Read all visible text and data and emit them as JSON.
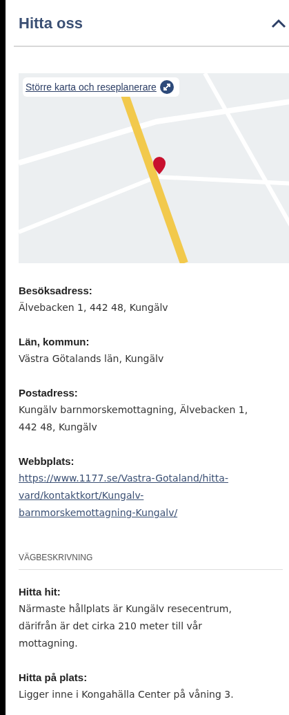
{
  "section": {
    "title": "Hitta oss",
    "expanded": true
  },
  "map": {
    "link": "Större karta och reseplanerare"
  },
  "details": [
    {
      "label": "Besöksadress:",
      "kind": "text",
      "lines": [
        "Älvebacken 1, 442 48, Kungälv"
      ]
    },
    {
      "label": "Län, kommun:",
      "kind": "text",
      "lines": [
        "Västra Götalands län, Kungälv"
      ]
    },
    {
      "label": "Postadress:",
      "kind": "text",
      "lines": [
        "Kungälv barnmorskemottagning, Älvebacken 1,",
        "442 48, Kungälv"
      ]
    },
    {
      "label": "Webbplats:",
      "kind": "link",
      "lines": [
        "https://www.1177.se/Vastra-Gotaland/hitta-",
        "vard/kontaktkort/Kungalv-",
        "barnmorskemottagning-Kungalv/"
      ]
    }
  ],
  "directions": {
    "heading": "VÄGBESKRIVNING",
    "items": [
      {
        "label": "Hitta hit:",
        "lines": [
          "Närmaste hållplats är Kungälv resecentrum,",
          "därifrån är det cirka 210 meter till vår",
          "mottagning."
        ]
      },
      {
        "label": "Hitta på plats:",
        "lines": [
          "Ligger inne i Kongahälla Center på våning 3."
        ]
      }
    ]
  }
}
